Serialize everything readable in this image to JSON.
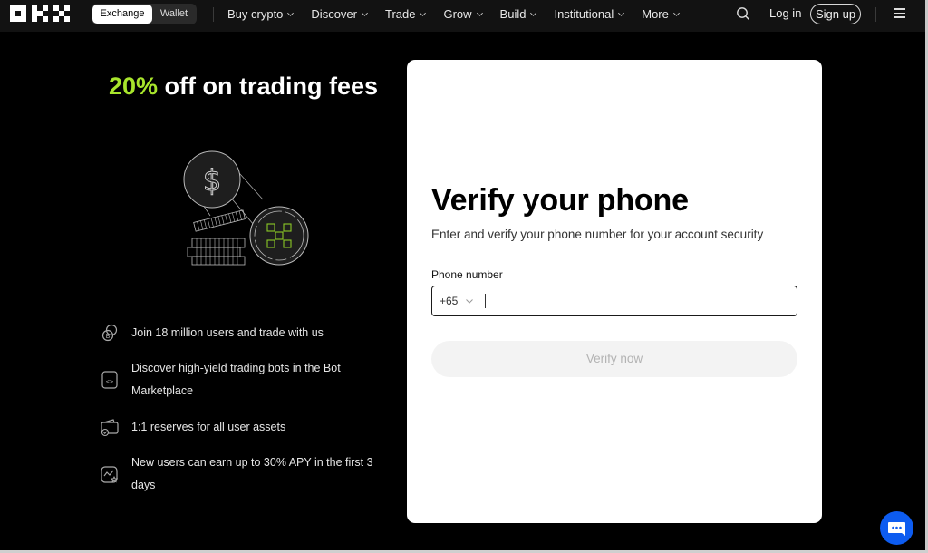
{
  "nav": {
    "logo_alt": "OKX",
    "toggle": {
      "exchange": "Exchange",
      "wallet": "Wallet",
      "active": "Exchange"
    },
    "menu": [
      {
        "label": "Buy crypto"
      },
      {
        "label": "Discover"
      },
      {
        "label": "Trade"
      },
      {
        "label": "Grow"
      },
      {
        "label": "Build"
      },
      {
        "label": "Institutional"
      },
      {
        "label": "More"
      }
    ],
    "login": "Log in",
    "signup": "Sign up"
  },
  "promo": {
    "accent_text": "20%",
    "title_rest": " off on trading fees",
    "accent_color": "#a8e52c",
    "features": [
      {
        "icon": "coins-exchange-icon",
        "text": "Join 18 million users and trade with us"
      },
      {
        "icon": "bot-code-icon",
        "text": "Discover high-yield trading bots in the Bot Marketplace"
      },
      {
        "icon": "wallet-check-icon",
        "text": "1:1 reserves for all user assets"
      },
      {
        "icon": "chart-star-icon",
        "text": "New users can earn up to 30% APY in the first 3 days"
      }
    ]
  },
  "form": {
    "title": "Verify your phone",
    "subtitle": "Enter and verify your phone number for your account security",
    "phone_label": "Phone number",
    "country_code": "+65",
    "phone_value": "",
    "phone_placeholder": "",
    "submit_label": "Verify now"
  },
  "colors": {
    "chat_button": "#0d5cf0",
    "nav_bg": "#121212"
  }
}
